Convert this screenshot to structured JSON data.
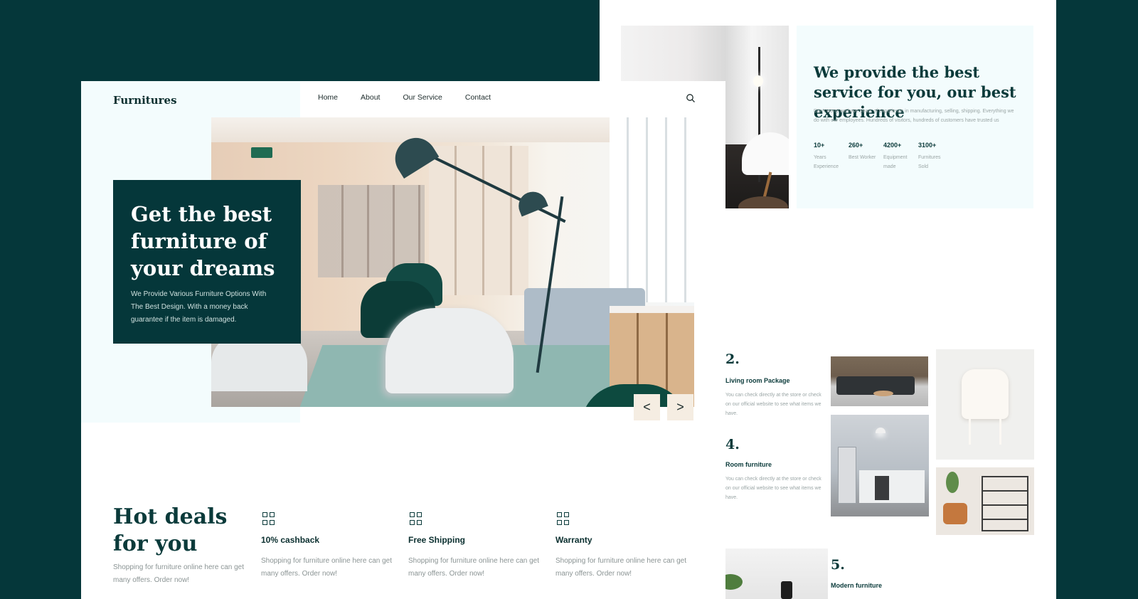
{
  "brand": "Furnitures",
  "nav": {
    "items": [
      "Home",
      "About",
      "Our Service",
      "Contact"
    ],
    "search_icon": "search-icon"
  },
  "hero": {
    "title": "Get the best furniture of your dreams",
    "description": "We Provide Various Furniture Options With The Best Design. With a money back guarantee if the item is damaged.",
    "prev_label": "<",
    "next_label": ">"
  },
  "deals": {
    "title": "Hot deals for you",
    "description": "Shopping for furniture online here can get many offers. Order now!",
    "features": [
      {
        "icon": "grid-icon",
        "title": "10% cashback",
        "description": "Shopping for furniture online here can get many offers. Order now!"
      },
      {
        "icon": "grid-icon",
        "title": "Free Shipping",
        "description": "Shopping for furniture online here can get many offers. Order now!"
      },
      {
        "icon": "grid-icon",
        "title": "Warranty",
        "description": "Shopping for furniture online here can get many offers. Order now!"
      }
    ]
  },
  "service": {
    "title": "We provide the best service for you, our best experience",
    "description": "Don't worry we have years of experience in manufacturing, selling, shipping. Everything we do with our employees. Hundreds of visitors, hundreds of customers have trusted us",
    "stats": [
      {
        "value": "10+",
        "label": "Years Experience"
      },
      {
        "value": "260+",
        "label": "Best Worker"
      },
      {
        "value": "4200+",
        "label": "Equipment made"
      },
      {
        "value": "3100+",
        "label": "Furnitures Sold"
      }
    ]
  },
  "packages": [
    {
      "number": "2.",
      "title": "Living  room Package",
      "description": "You can check directly at the store or check on our official website to see what items we have."
    },
    {
      "number": "4.",
      "title": "Room furniture",
      "description": "You can check directly at the store or check on our official website to see what items we have."
    },
    {
      "number": "5.",
      "title": "Modern furniture"
    }
  ],
  "colors": {
    "background": "#05373a",
    "accent": "#05373a",
    "hero_panel": "#f3fcfd",
    "slider_button": "#f5ede2"
  }
}
